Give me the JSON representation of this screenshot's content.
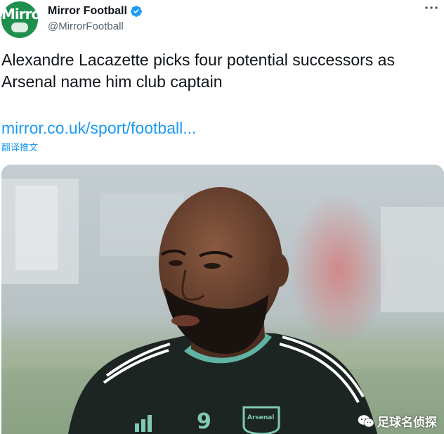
{
  "account": {
    "display_name": "Mirror Football",
    "handle": "@MirrorFootball",
    "avatar_text": "Mirror",
    "verified": true
  },
  "tweet": {
    "text_line_1": "Alexandre Lacazette picks four potential successors as",
    "text_line_2": "Arsenal name him club captain",
    "link": "mirror.co.uk/sport/football...",
    "translate": "翻译推文"
  },
  "media": {
    "description_icons": [
      "wechat-icon"
    ],
    "shirt_number": "9",
    "crest_text": "Arsenal",
    "watermark": "足球名侦探"
  },
  "colors": {
    "link": "#1d9bf0",
    "verified": "#1d9bf0",
    "avatar_bg": "#1f8f4e",
    "text": "#0f1419",
    "secondary_text": "#536471"
  }
}
